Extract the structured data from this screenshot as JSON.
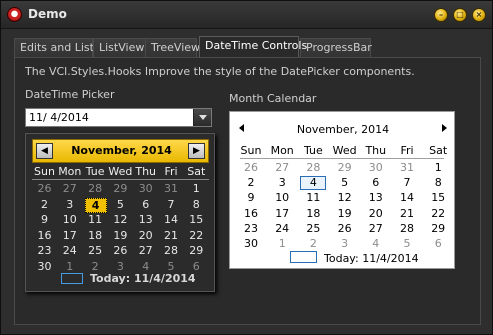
{
  "window": {
    "title": "Demo"
  },
  "tabs": [
    "Edits and Lists",
    "ListView",
    "TreeView",
    "DateTime Controls",
    "ProgressBar"
  ],
  "active_tab": "DateTime Controls",
  "description": "The VCl.Styles.Hooks Improve the style of the DatePicker components.",
  "datetime_picker": {
    "label": "DateTime Picker",
    "value": "11/  4/2014"
  },
  "dropdown_calendar": {
    "month_title": "November, 2014",
    "weekdays": [
      "Sun",
      "Mon",
      "Tue",
      "Wed",
      "Thu",
      "Fri",
      "Sat"
    ],
    "weeks": [
      [
        "26",
        "27",
        "28",
        "29",
        "30",
        "31",
        "1"
      ],
      [
        "2",
        "3",
        "4",
        "5",
        "6",
        "7",
        "8"
      ],
      [
        "9",
        "10",
        "11",
        "12",
        "13",
        "14",
        "15"
      ],
      [
        "16",
        "17",
        "18",
        "19",
        "20",
        "21",
        "22"
      ],
      [
        "23",
        "24",
        "25",
        "26",
        "27",
        "28",
        "29"
      ],
      [
        "30",
        "1",
        "2",
        "3",
        "4",
        "5",
        "6"
      ]
    ],
    "selected_day": "4",
    "today_text": "Today: 11/4/2014",
    "accent_color": "#f0c000"
  },
  "month_calendar": {
    "label": "Month Calendar",
    "month_title": "November, 2014",
    "weekdays": [
      "Sun",
      "Mon",
      "Tue",
      "Wed",
      "Thu",
      "Fri",
      "Sat"
    ],
    "weeks": [
      [
        "26",
        "27",
        "28",
        "29",
        "30",
        "31",
        "1"
      ],
      [
        "2",
        "3",
        "4",
        "5",
        "6",
        "7",
        "8"
      ],
      [
        "9",
        "10",
        "11",
        "12",
        "13",
        "14",
        "15"
      ],
      [
        "16",
        "17",
        "18",
        "19",
        "20",
        "21",
        "22"
      ],
      [
        "23",
        "24",
        "25",
        "26",
        "27",
        "28",
        "29"
      ],
      [
        "30",
        "1",
        "2",
        "3",
        "4",
        "5",
        "6"
      ]
    ],
    "today_day": "4",
    "today_text": "Today: 11/4/2014",
    "accent_color": "#2a6fb5"
  },
  "icons": {
    "app": "app-logo-icon",
    "minimize": "minimize-icon",
    "maximize": "maximize-icon",
    "close": "close-icon",
    "dropdown": "chevron-down-icon",
    "prev": "chevron-left-icon",
    "next": "chevron-right-icon"
  }
}
